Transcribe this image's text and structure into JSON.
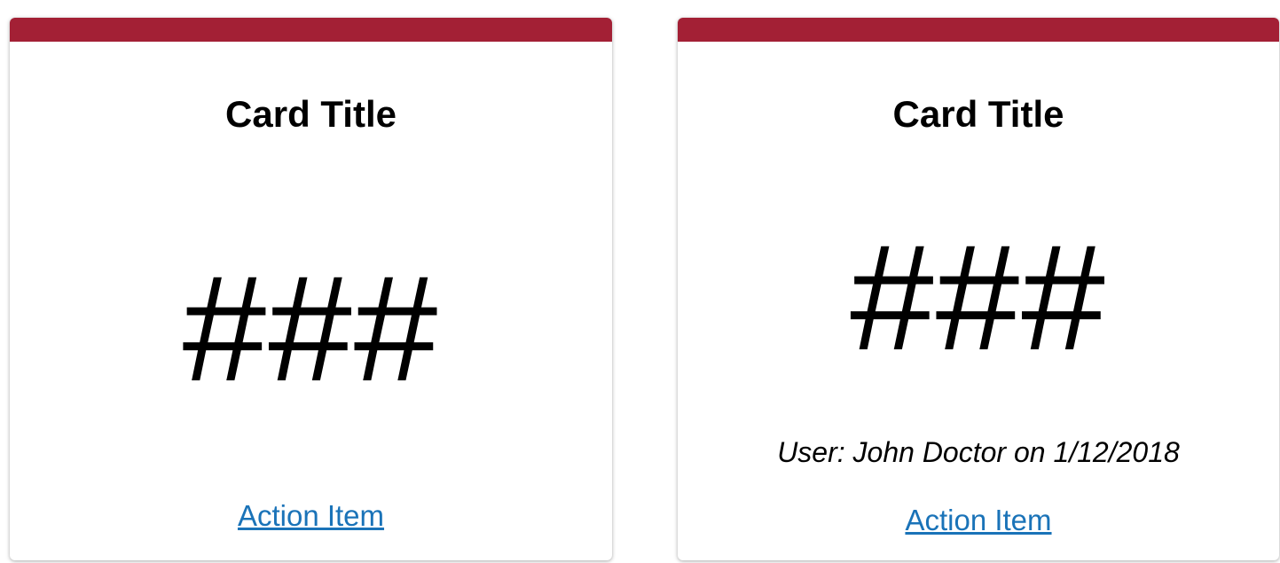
{
  "colors": {
    "accent": "#a32035",
    "link": "#1a73b8"
  },
  "cards": [
    {
      "title": "Card Title",
      "value": "###",
      "action_label": "Action Item"
    },
    {
      "title": "Card Title",
      "value": "###",
      "meta": "User: John Doctor on 1/12/2018",
      "action_label": "Action Item"
    }
  ]
}
